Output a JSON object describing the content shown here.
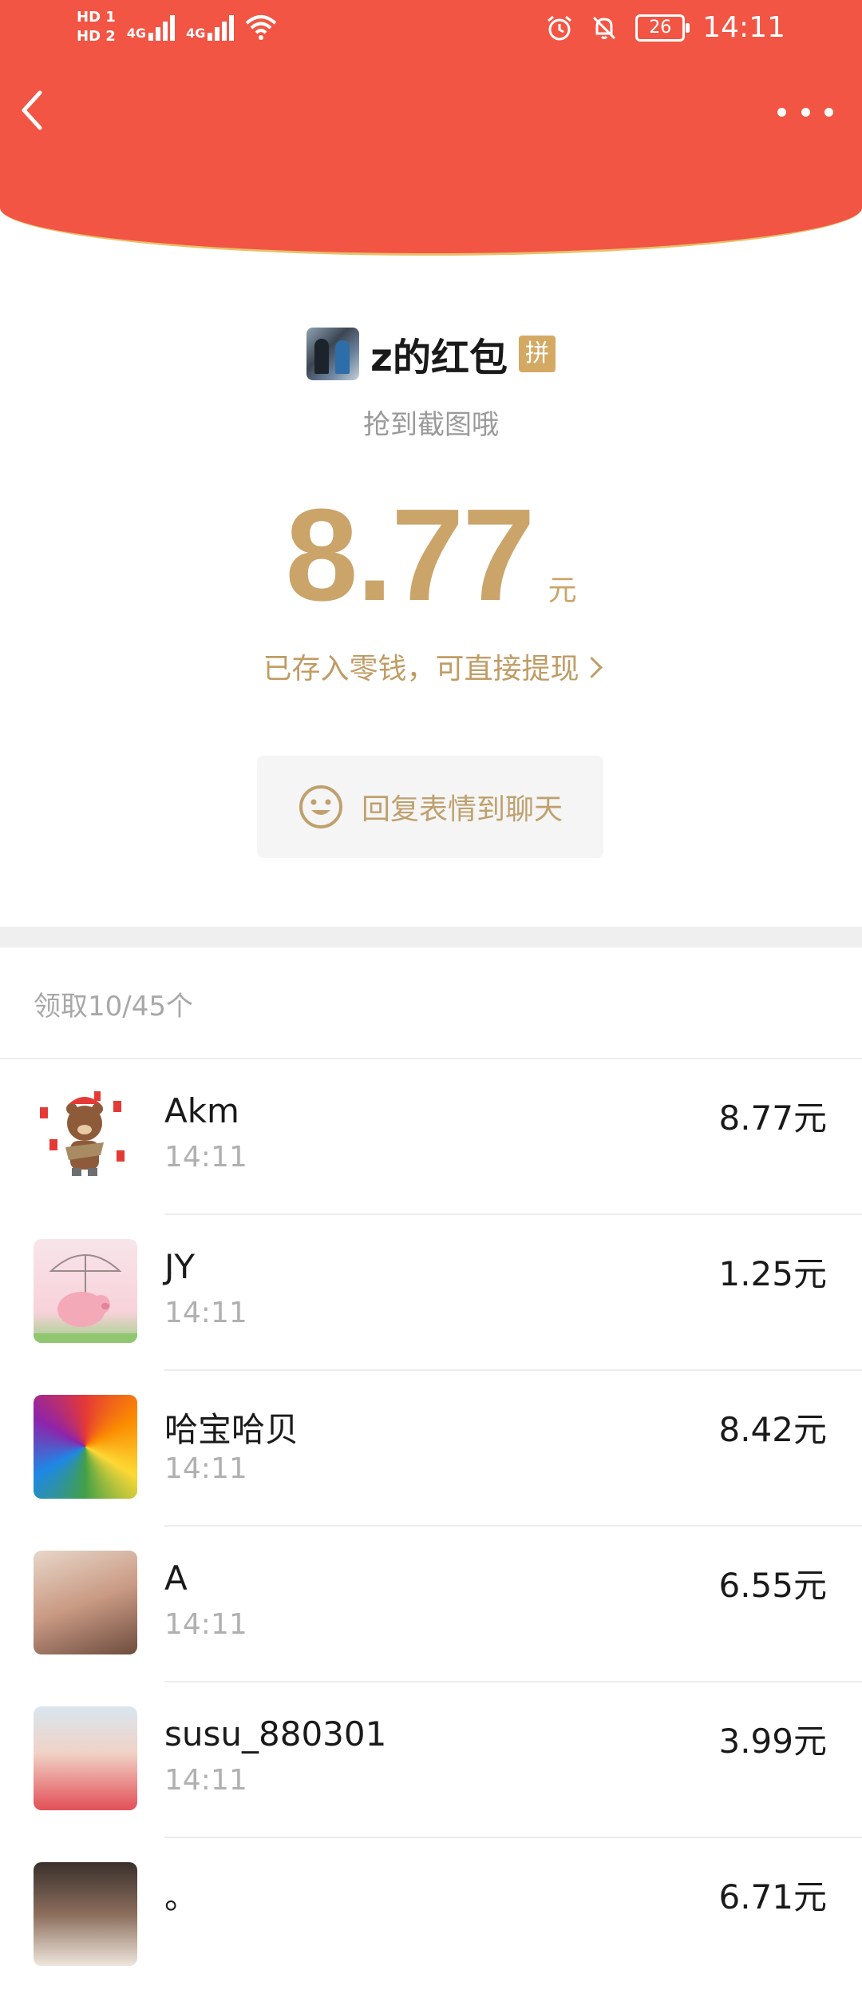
{
  "status_bar": {
    "hd1": "HD 1",
    "hd2": "HD 2",
    "net1": "4G",
    "net2": "4G",
    "battery": "26",
    "time": "14:11",
    "icons": [
      "wifi-icon",
      "alarm-icon",
      "bell-off-icon",
      "battery-icon"
    ]
  },
  "nav": {
    "back_icon": "chevron-left-icon",
    "more_icon": "more-dots-icon"
  },
  "colors": {
    "header_red": "#f25544",
    "gold": "#cba46a"
  },
  "packet": {
    "sender": "z的红包",
    "badge": "拼",
    "greeting": "抢到截图哦",
    "amount": "8.77",
    "unit": "元",
    "saved_note": "已存入零钱，可直接提现",
    "reply_label": "回复表情到聊天"
  },
  "summary": "领取10/45个",
  "recipients": [
    {
      "name": "Akm",
      "time": "14:11",
      "amount": "8.77元"
    },
    {
      "name": "JY",
      "time": "14:11",
      "amount": "1.25元"
    },
    {
      "name": "哈宝哈贝",
      "time": "14:11",
      "amount": "8.42元"
    },
    {
      "name": "A",
      "time": "14:11",
      "amount": "6.55元"
    },
    {
      "name": "susu_880301",
      "time": "14:11",
      "amount": "3.99元"
    },
    {
      "name": "。",
      "time": "",
      "amount": "6.71元"
    }
  ]
}
